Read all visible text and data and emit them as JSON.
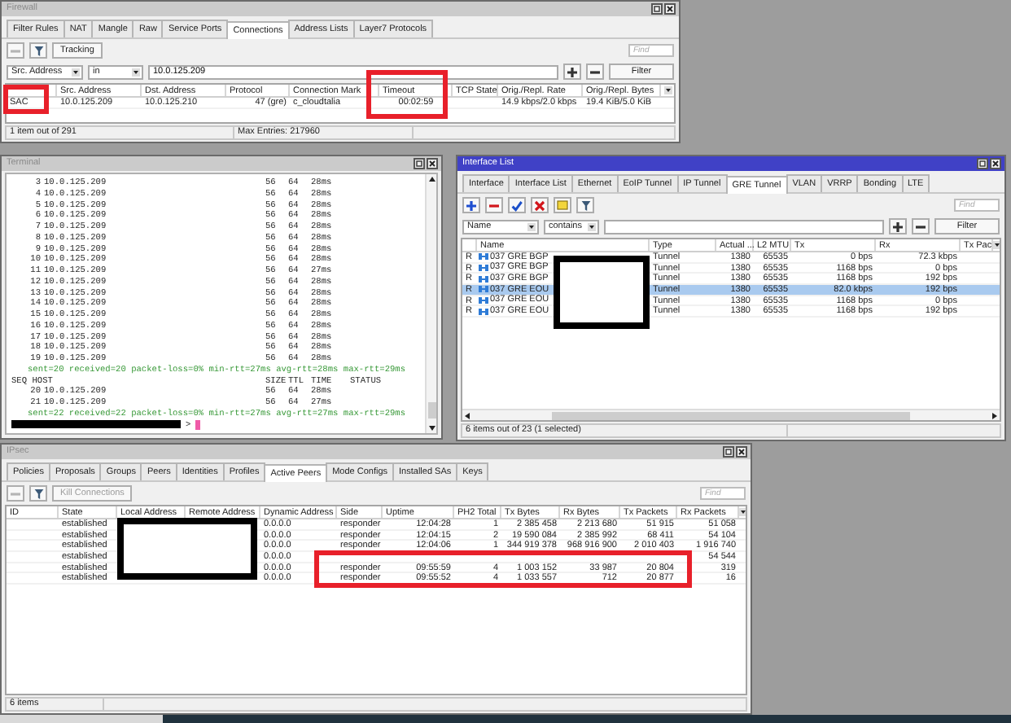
{
  "firewall": {
    "title": "Firewall",
    "active": false,
    "tabs": [
      {
        "label": "Filter Rules",
        "selected": false
      },
      {
        "label": "NAT",
        "selected": false
      },
      {
        "label": "Mangle",
        "selected": false
      },
      {
        "label": "Raw",
        "selected": false
      },
      {
        "label": "Service Ports",
        "selected": false
      },
      {
        "label": "Connections",
        "selected": true
      },
      {
        "label": "Address Lists",
        "selected": false
      },
      {
        "label": "Layer7 Protocols",
        "selected": false
      }
    ],
    "tracking_button": {
      "label": "Tracking",
      "disabled": false
    },
    "find": {
      "placeholder": "Find"
    },
    "filter": {
      "field": "Src. Address",
      "operator": "in",
      "value": "10.0.125.209",
      "button": "Filter"
    },
    "table": {
      "columns": [
        null,
        "Src. Address",
        "Dst. Address",
        "Protocol",
        "Connection Mark",
        "Timeout",
        "TCP State",
        "Orig./Repl. Rate",
        "Orig./Repl. Bytes"
      ],
      "rows": [
        {
          "selected": false,
          "cells": [
            "SAC",
            "10.0.125.209",
            "10.0.125.210",
            "47 (gre)",
            "c_cloudtalia",
            "00:02:59",
            null,
            "14.9 kbps/2.0 kbps",
            "19.4 KiB/5.0 KiB"
          ]
        }
      ]
    },
    "status_bar": [
      "1 item out of 291",
      "Max Entries: 217960"
    ]
  },
  "terminal": {
    "title": "Terminal",
    "active": false,
    "lines": [
      {
        "kind": "reply",
        "seq": "3",
        "host": "10.0.125.209",
        "size": "56",
        "ttl": "64",
        "time": "28ms"
      },
      {
        "kind": "reply",
        "seq": "4",
        "host": "10.0.125.209",
        "size": "56",
        "ttl": "64",
        "time": "28ms"
      },
      {
        "kind": "reply",
        "seq": "5",
        "host": "10.0.125.209",
        "size": "56",
        "ttl": "64",
        "time": "28ms"
      },
      {
        "kind": "reply",
        "seq": "6",
        "host": "10.0.125.209",
        "size": "56",
        "ttl": "64",
        "time": "28ms"
      },
      {
        "kind": "reply",
        "seq": "7",
        "host": "10.0.125.209",
        "size": "56",
        "ttl": "64",
        "time": "28ms"
      },
      {
        "kind": "reply",
        "seq": "8",
        "host": "10.0.125.209",
        "size": "56",
        "ttl": "64",
        "time": "28ms"
      },
      {
        "kind": "reply",
        "seq": "9",
        "host": "10.0.125.209",
        "size": "56",
        "ttl": "64",
        "time": "28ms"
      },
      {
        "kind": "reply",
        "seq": "10",
        "host": "10.0.125.209",
        "size": "56",
        "ttl": "64",
        "time": "28ms"
      },
      {
        "kind": "reply",
        "seq": "11",
        "host": "10.0.125.209",
        "size": "56",
        "ttl": "64",
        "time": "27ms"
      },
      {
        "kind": "reply",
        "seq": "12",
        "host": "10.0.125.209",
        "size": "56",
        "ttl": "64",
        "time": "28ms"
      },
      {
        "kind": "reply",
        "seq": "13",
        "host": "10.0.125.209",
        "size": "56",
        "ttl": "64",
        "time": "28ms"
      },
      {
        "kind": "reply",
        "seq": "14",
        "host": "10.0.125.209",
        "size": "56",
        "ttl": "64",
        "time": "28ms"
      },
      {
        "kind": "reply",
        "seq": "15",
        "host": "10.0.125.209",
        "size": "56",
        "ttl": "64",
        "time": "28ms"
      },
      {
        "kind": "reply",
        "seq": "16",
        "host": "10.0.125.209",
        "size": "56",
        "ttl": "64",
        "time": "28ms"
      },
      {
        "kind": "reply",
        "seq": "17",
        "host": "10.0.125.209",
        "size": "56",
        "ttl": "64",
        "time": "28ms"
      },
      {
        "kind": "reply",
        "seq": "18",
        "host": "10.0.125.209",
        "size": "56",
        "ttl": "64",
        "time": "28ms"
      },
      {
        "kind": "reply",
        "seq": "19",
        "host": "10.0.125.209",
        "size": "56",
        "ttl": "64",
        "time": "28ms"
      },
      {
        "kind": "summary",
        "text": "sent=20 received=20 packet-loss=0% min-rtt=27ms avg-rtt=28ms max-rtt=29ms"
      },
      {
        "kind": "header",
        "cells": [
          "SEQ HOST",
          "SIZE",
          "TTL",
          "TIME",
          "STATUS"
        ]
      },
      {
        "kind": "reply",
        "seq": "20",
        "host": "10.0.125.209",
        "size": "56",
        "ttl": "64",
        "time": "28ms"
      },
      {
        "kind": "reply",
        "seq": "21",
        "host": "10.0.125.209",
        "size": "56",
        "ttl": "64",
        "time": "27ms"
      },
      {
        "kind": "summary",
        "text": "sent=22 received=22 packet-loss=0% min-rtt=27ms avg-rtt=27ms max-rtt=29ms"
      }
    ],
    "prompt": ">"
  },
  "interface_list": {
    "title": "Interface List",
    "active": true,
    "tabs": [
      {
        "label": "Interface",
        "selected": false
      },
      {
        "label": "Interface List",
        "selected": false
      },
      {
        "label": "Ethernet",
        "selected": false
      },
      {
        "label": "EoIP Tunnel",
        "selected": false
      },
      {
        "label": "IP Tunnel",
        "selected": false
      },
      {
        "label": "GRE Tunnel",
        "selected": true
      },
      {
        "label": "VLAN",
        "selected": false
      },
      {
        "label": "VRRP",
        "selected": false
      },
      {
        "label": "Bonding",
        "selected": false
      },
      {
        "label": "LTE",
        "selected": false
      }
    ],
    "find": {
      "placeholder": "Find"
    },
    "filter": {
      "field": "Name",
      "operator": "contains",
      "button": "Filter"
    },
    "table": {
      "columns": [
        null,
        "Name",
        "Type",
        "Actual ...",
        "L2 MTU",
        "Tx",
        "Rx",
        "Tx Pac"
      ],
      "rows": [
        {
          "selected": false,
          "cells": [
            "R",
            "037 GRE BGP",
            "Tunnel",
            "1380",
            "65535",
            "0 bps",
            "72.3 kbps",
            null
          ]
        },
        {
          "selected": false,
          "cells": [
            "R",
            "037 GRE BGP",
            "Tunnel",
            "1380",
            "65535",
            "1168 bps",
            "0 bps",
            null
          ]
        },
        {
          "selected": false,
          "cells": [
            "R",
            "037 GRE BGP",
            "Tunnel",
            "1380",
            "65535",
            "1168 bps",
            "192 bps",
            null
          ]
        },
        {
          "selected": true,
          "cells": [
            "R",
            "037 GRE EOU",
            "Tunnel",
            "1380",
            "65535",
            "82.0 kbps",
            "192 bps",
            null
          ]
        },
        {
          "selected": false,
          "cells": [
            "R",
            "037 GRE EOU",
            "Tunnel",
            "1380",
            "65535",
            "1168 bps",
            "0 bps",
            null
          ]
        },
        {
          "selected": false,
          "cells": [
            "R",
            "037 GRE EOU",
            "Tunnel",
            "1380",
            "65535",
            "1168 bps",
            "192 bps",
            null
          ]
        }
      ]
    },
    "status_bar": [
      "6 items out of 23 (1 selected)"
    ]
  },
  "ipsec": {
    "title": "IPsec",
    "active": false,
    "tabs": [
      {
        "label": "Policies",
        "selected": false
      },
      {
        "label": "Proposals",
        "selected": false
      },
      {
        "label": "Groups",
        "selected": false
      },
      {
        "label": "Peers",
        "selected": false
      },
      {
        "label": "Identities",
        "selected": false
      },
      {
        "label": "Profiles",
        "selected": false
      },
      {
        "label": "Active Peers",
        "selected": true
      },
      {
        "label": "Mode Configs",
        "selected": false
      },
      {
        "label": "Installed SAs",
        "selected": false
      },
      {
        "label": "Keys",
        "selected": false
      }
    ],
    "kill_button": {
      "label": "Kill Connections",
      "disabled": true
    },
    "find": {
      "placeholder": "Find"
    },
    "table": {
      "columns": [
        "ID",
        "State",
        "Local Address",
        "Remote Address",
        "Dynamic Address",
        "Side",
        "Uptime",
        "PH2 Total",
        "Tx Bytes",
        "Rx Bytes",
        "Tx Packets",
        "Rx Packets"
      ],
      "rows": [
        {
          "selected": false,
          "cells": [
            null,
            "established",
            null,
            null,
            "0.0.0.0",
            "responder",
            "12:04:28",
            "1",
            "2 385 458",
            "2 213 680",
            "51 915",
            "51 058"
          ]
        },
        {
          "selected": false,
          "cells": [
            null,
            "established",
            null,
            null,
            "0.0.0.0",
            "responder",
            "12:04:15",
            "2",
            "19 590 084",
            "2 385 992",
            "68 411",
            "54 104"
          ]
        },
        {
          "selected": false,
          "cells": [
            null,
            "established",
            null,
            null,
            "0.0.0.0",
            "responder",
            "12:04:06",
            "1",
            "344 919 378",
            "968 916 900",
            "2 010 403",
            "1 916 740"
          ]
        },
        {
          "selected": false,
          "cells": [
            null,
            "established",
            null,
            null,
            "0.0.0.0",
            null,
            null,
            null,
            null,
            null,
            null,
            "54 544"
          ]
        },
        {
          "selected": false,
          "cells": [
            null,
            "established",
            null,
            null,
            "0.0.0.0",
            "responder",
            "09:55:59",
            "4",
            "1 003 152",
            "33 987",
            "20 804",
            "319"
          ]
        },
        {
          "selected": false,
          "cells": [
            null,
            "established",
            null,
            null,
            "0.0.0.0",
            "responder",
            "09:55:52",
            "4",
            "1 033 557",
            "712",
            "20 877",
            "16"
          ]
        }
      ]
    },
    "status_bar": [
      "6 items"
    ]
  }
}
